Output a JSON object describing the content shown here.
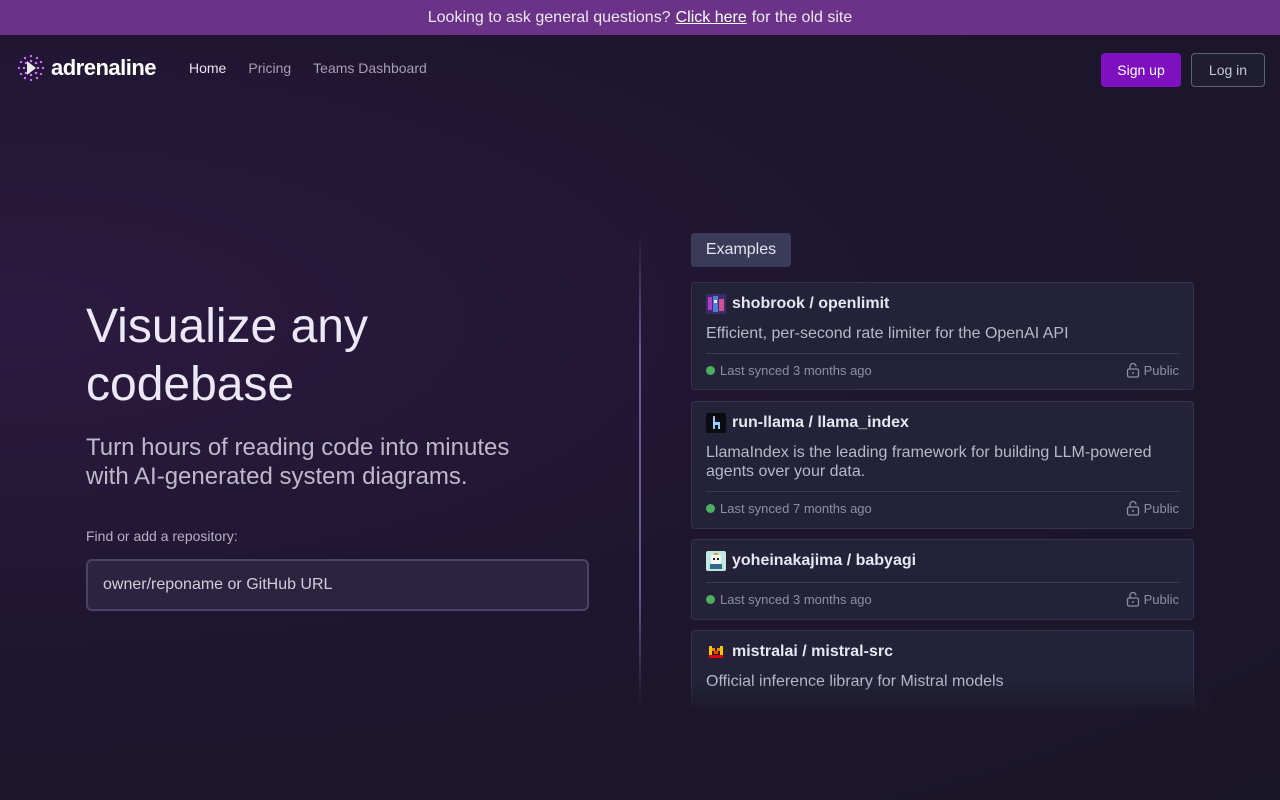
{
  "banner": {
    "text_before": "Looking to ask general questions?",
    "link": "Click here",
    "text_after": "for the old site"
  },
  "brand": {
    "name": "adrenaline",
    "logo_icon": "adrenaline-logo-icon"
  },
  "nav": {
    "links": [
      {
        "label": "Home",
        "active": true
      },
      {
        "label": "Pricing",
        "active": false
      },
      {
        "label": "Teams Dashboard",
        "active": false
      }
    ],
    "signup_label": "Sign up",
    "login_label": "Log in"
  },
  "hero": {
    "title": "Visualize any codebase",
    "subtitle": "Turn hours of reading code into minutes with AI-generated system diagrams."
  },
  "repo": {
    "label": "Find or add a repository:",
    "placeholder": "owner/reponame or GitHub URL",
    "value": ""
  },
  "examples": {
    "tab_label": "Examples",
    "cards": [
      {
        "name": "shobrook / openlimit",
        "description": "Efficient, per-second rate limiter for the OpenAI API",
        "synced": "Last synced 3 months ago",
        "visibility": "Public",
        "avatar_icon": "shobrook-avatar"
      },
      {
        "name": "run-llama / llama_index",
        "description": "LlamaIndex is the leading framework for building LLM-powered agents over your data.",
        "synced": "Last synced 7 months ago",
        "visibility": "Public",
        "avatar_icon": "llama-avatar"
      },
      {
        "name": "yoheinakajima / babyagi",
        "description": "",
        "synced": "Last synced 3 months ago",
        "visibility": "Public",
        "avatar_icon": "babyagi-avatar"
      },
      {
        "name": "mistralai / mistral-src",
        "description": "Official inference library for Mistral models",
        "synced": "",
        "visibility": "",
        "avatar_icon": "mistral-avatar"
      }
    ]
  },
  "colors": {
    "banner_bg": "#6b3387",
    "accent": "#7e10bf",
    "status_green": "#4caf5f"
  }
}
